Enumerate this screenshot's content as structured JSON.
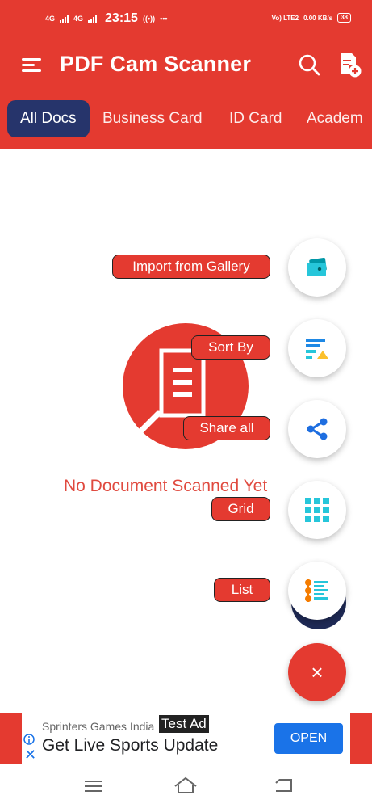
{
  "status_bar": {
    "net1": "4G",
    "net2": "4G",
    "time": "23:15",
    "volte": "Vo) LTE2",
    "speed": "0.00 KB/s",
    "battery": "38"
  },
  "app_bar": {
    "title": "PDF Cam Scanner",
    "icons": [
      "menu-icon",
      "search-icon",
      "add-document-icon"
    ]
  },
  "tabs": [
    "All Docs",
    "Business Card",
    "ID Card",
    "Academ"
  ],
  "empty_state": {
    "message": "No Document Scanned Yet"
  },
  "fab_menu": [
    {
      "label": "Import from Gallery",
      "icon": "gallery-icon"
    },
    {
      "label": "Sort By",
      "icon": "sort-icon"
    },
    {
      "label": "Share all",
      "icon": "share-icon"
    },
    {
      "label": "Grid",
      "icon": "grid-icon"
    },
    {
      "label": "List",
      "icon": "list-icon"
    }
  ],
  "fab_close": "×",
  "ad": {
    "sponsor": "Sprinters Games India",
    "tag": "Test Ad",
    "headline": "Get Live Sports Update",
    "cta": "OPEN"
  },
  "colors": {
    "primary": "#e43a30",
    "tab_active": "#26346b",
    "fab_icon": "#00bcd4",
    "ad_button": "#1a73e8"
  }
}
